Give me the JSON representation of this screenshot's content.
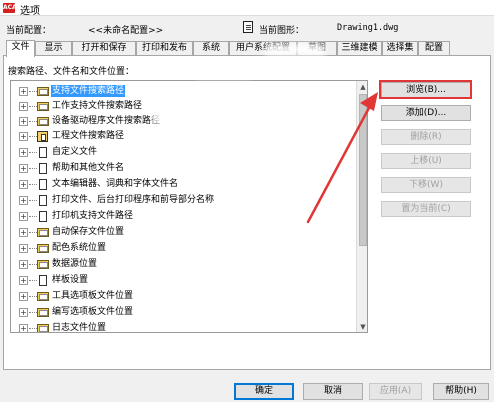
{
  "window": {
    "title": "选项",
    "icon_text": "ACAD"
  },
  "profile": {
    "label": "当前配置：",
    "value": "<<未命名配置>>"
  },
  "drawing": {
    "label": "当前图形：",
    "value": "Drawing1.dwg",
    "icon": "drawing-file-icon"
  },
  "tabs": [
    {
      "label": "文件",
      "active": true
    },
    {
      "label": "显示"
    },
    {
      "label": "打开和保存"
    },
    {
      "label": "打印和发布"
    },
    {
      "label": "系统"
    },
    {
      "label": "用户系统配置"
    },
    {
      "label": "草图"
    },
    {
      "label": "三维建模"
    },
    {
      "label": "选择集"
    },
    {
      "label": "配置"
    }
  ],
  "search_paths_label": "搜索路径、文件名和文件位置：",
  "tree": {
    "items": [
      {
        "label": "支持文件搜索路径",
        "icon": "folder-icon",
        "selected": true
      },
      {
        "label": "工作支持文件搜索路径",
        "icon": "folder-icon"
      },
      {
        "label": "设备驱动程序文件搜索路径",
        "icon": "folder-icon"
      },
      {
        "label": "工程文件搜索路径",
        "icon": "project-icon"
      },
      {
        "label": "自定义文件",
        "icon": "document-icon"
      },
      {
        "label": "帮助和其他文件名",
        "icon": "document-icon"
      },
      {
        "label": "文本编辑器、词典和字体文件名",
        "icon": "document-icon"
      },
      {
        "label": "打印文件、后台打印程序和前导部分名称",
        "icon": "document-icon"
      },
      {
        "label": "打印机支持文件路径",
        "icon": "document-icon"
      },
      {
        "label": "自动保存文件位置",
        "icon": "folder-icon"
      },
      {
        "label": "配色系统位置",
        "icon": "folder-icon"
      },
      {
        "label": "数据源位置",
        "icon": "folder-icon"
      },
      {
        "label": "样板设置",
        "icon": "document-icon"
      },
      {
        "label": "工具选项板文件位置",
        "icon": "folder-icon"
      },
      {
        "label": "编写选项板文件位置",
        "icon": "folder-icon"
      },
      {
        "label": "日志文件位置",
        "icon": "folder-icon"
      }
    ],
    "expander_symbol": "+"
  },
  "side_buttons": {
    "browse": "浏览(B)...",
    "add": "添加(D)...",
    "remove": "删除(R)",
    "move_up": "上移(U)",
    "move_down": "下移(W)",
    "set_current": "置为当前(C)"
  },
  "bottom_buttons": {
    "ok": "确定",
    "cancel": "取消",
    "apply": "应用(A)",
    "help": "帮助(H)"
  },
  "colors": {
    "selection": "#3399ff",
    "annotation": "#e23535",
    "default_button": "#0078d7"
  },
  "icons": {
    "scroll_up": "▲",
    "scroll_down": "▼"
  }
}
